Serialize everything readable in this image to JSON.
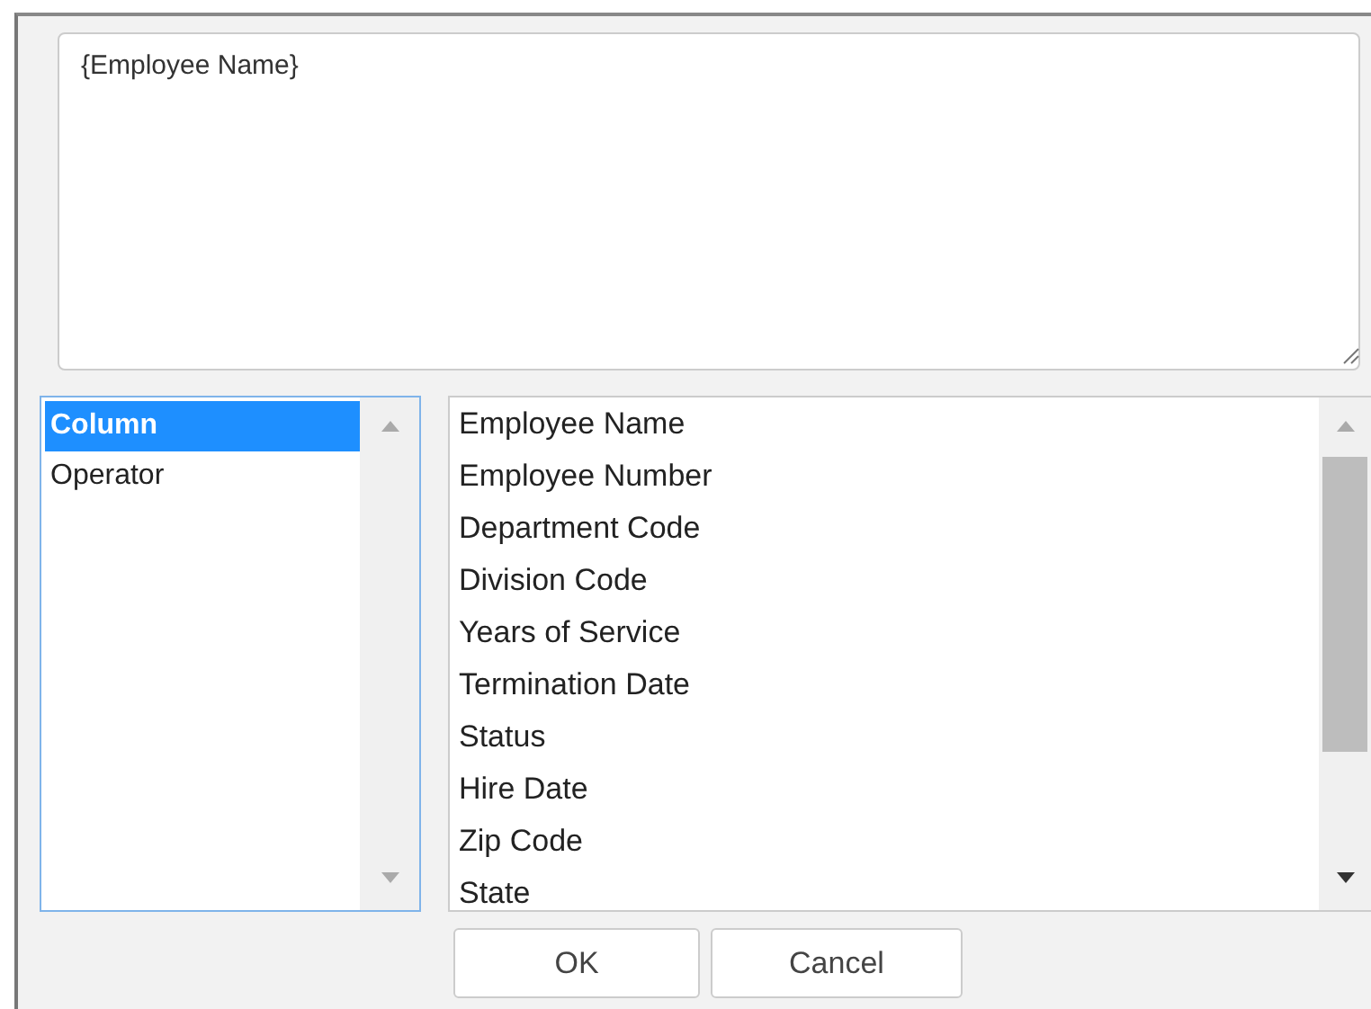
{
  "expression": {
    "value": "{Employee Name}"
  },
  "categories": [
    {
      "label": "Column",
      "selected": true
    },
    {
      "label": "Operator",
      "selected": false
    }
  ],
  "columns": [
    {
      "label": "Employee Name",
      "selected": false
    },
    {
      "label": "Employee Number",
      "selected": false
    },
    {
      "label": "Department Code",
      "selected": false
    },
    {
      "label": "Division Code",
      "selected": false
    },
    {
      "label": "Years of Service",
      "selected": false
    },
    {
      "label": "Termination Date",
      "selected": false
    },
    {
      "label": "Status",
      "selected": false
    },
    {
      "label": "Hire Date",
      "selected": false
    },
    {
      "label": "Zip Code",
      "selected": false
    },
    {
      "label": "State",
      "selected": false
    }
  ],
  "buttons": [
    "OK",
    "Cancel"
  ]
}
